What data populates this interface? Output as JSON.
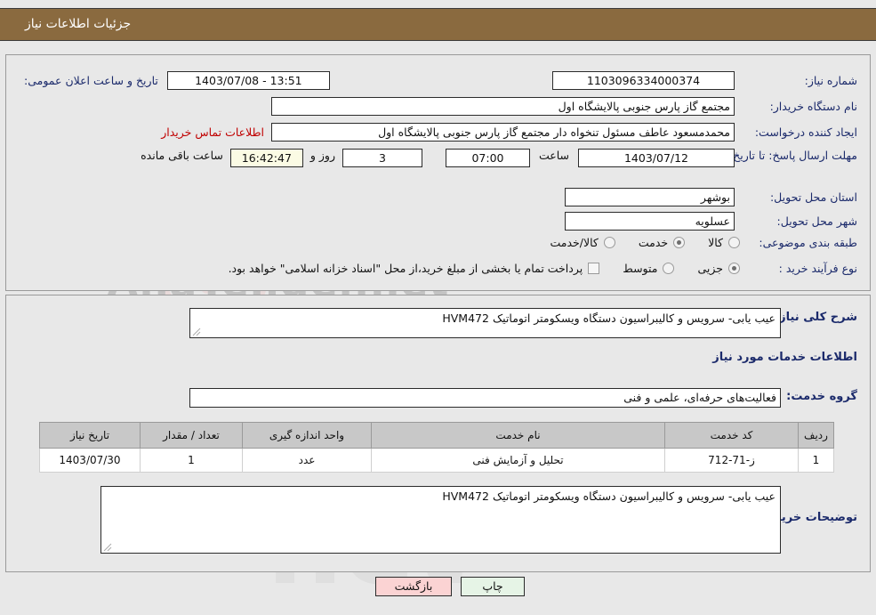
{
  "header": {
    "title": "جزئیات اطلاعات نیاز"
  },
  "top_form": {
    "need_number": {
      "label": "شماره نیاز:",
      "value": "1103096334000374"
    },
    "announce_datetime": {
      "label": "تاریخ و ساعت اعلان عمومی:",
      "value": "1403/07/08 - 13:51"
    },
    "buyer_org": {
      "label": "نام دستگاه خریدار:",
      "value": "مجتمع گاز پارس جنوبی  پالایشگاه اول"
    },
    "requester": {
      "label": "ایجاد کننده درخواست:",
      "value": "محمدمسعود عاطف مسئول تنخواه دار مجتمع گاز پارس جنوبی  پالایشگاه اول"
    },
    "contact_link": {
      "label": "اطلاعات تماس خریدار"
    },
    "deadline": {
      "label": "مهلت ارسال پاسخ: تا تاریخ:",
      "date": "1403/07/12",
      "time_label": "ساعت",
      "time": "07:00",
      "days": "3",
      "days_label": "روز و",
      "countdown": "16:42:47",
      "countdown_label": "ساعت باقی مانده"
    },
    "province": {
      "label": "استان محل تحویل:",
      "value": "بوشهر"
    },
    "city": {
      "label": "شهر محل تحویل:",
      "value": "عسلویه"
    },
    "category": {
      "label": "طبقه بندی موضوعی:",
      "options": [
        "کالا",
        "خدمت",
        "کالا/خدمت"
      ],
      "selected": "خدمت"
    },
    "purchase_type": {
      "label": "نوع فرآیند خرید :",
      "options": [
        "جزیی",
        "متوسط"
      ],
      "selected": "جزیی",
      "checkbox_note": "پرداخت تمام یا بخشی از مبلغ خرید،از محل \"اسناد خزانه اسلامی\" خواهد بود.",
      "checkbox_checked": false
    }
  },
  "bottom": {
    "need_summary": {
      "label": "شرح کلی نیاز:",
      "value": "عیب یابی- سرویس و کالیبراسیون دستگاه ویسکومتر اتوماتیک HVM472"
    },
    "services_heading": "اطلاعات خدمات مورد نیاز",
    "service_group": {
      "label": "گروه خدمت:",
      "value": "فعالیت‌های حرفه‌ای، علمی و فنی"
    },
    "table": {
      "columns": [
        "ردیف",
        "کد خدمت",
        "نام خدمت",
        "واحد اندازه گیری",
        "تعداد / مقدار",
        "تاریخ نیاز"
      ],
      "rows": [
        {
          "radif": "1",
          "code": "ز-71-712",
          "name": "تحلیل و آزمایش فنی",
          "unit": "عدد",
          "qty": "1",
          "date": "1403/07/30"
        }
      ]
    },
    "buyer_notes": {
      "label": "توضیحات خریدار:",
      "value": "عیب یابی- سرویس و کالیبراسیون دستگاه ویسکومتر اتوماتیک HVM472"
    }
  },
  "footer": {
    "print_label": "چاپ",
    "back_label": "بازگشت"
  },
  "watermark": {
    "text": "AnaTender.net",
    "big": "net"
  },
  "colors": {
    "header_band": "#8a6a3f",
    "label_blue": "#1b2a6b",
    "link_red": "#c00000",
    "print_btn": "#e6f4e6",
    "back_btn": "#fbd3d3"
  }
}
